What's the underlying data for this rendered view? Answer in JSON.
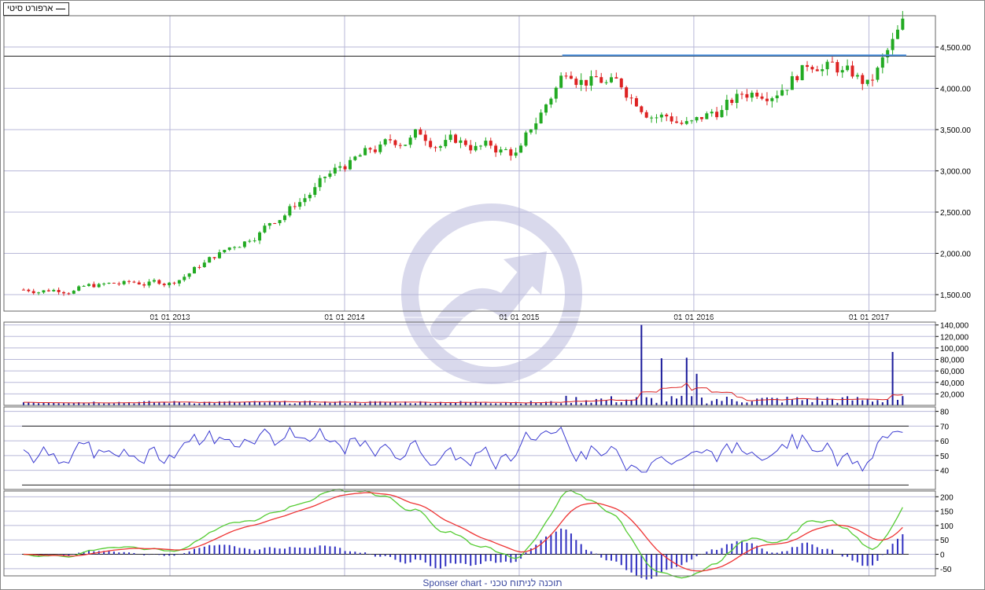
{
  "legend": {
    "label": "ארפורט סיטי"
  },
  "footer": {
    "text": "Sponser chart - תוכנה לניתוח טכני"
  },
  "colors": {
    "up": "#22aa22",
    "down": "#dd2222",
    "volume": "#1a1a9a",
    "volume_ma": "#dd2222",
    "rsi": "#3a3ad0",
    "macd_hist": "#3030c0",
    "macd_line": "#55cc33",
    "signal_line": "#ee3333",
    "resistance": "#4a90e0",
    "grid": "#b8b8d8",
    "watermark": "#d9d9ec"
  },
  "chart_data": [
    {
      "type": "candlestick",
      "title": "",
      "x_tick_labels": [
        "01-01-2013",
        "01-01-2014",
        "01-01-2015",
        "01-01-2016",
        "01-01-2017"
      ],
      "y_tick_labels": [
        "1,500.00",
        "2,000.00",
        "2,500.00",
        "3,000.00",
        "3,500.00",
        "4,000.00",
        "4,500.00"
      ],
      "ylim": [
        1300,
        4880
      ],
      "dates": [
        "2012-03-01",
        "2013-01-01",
        "2013-06-01",
        "2014-01-01",
        "2014-06-01",
        "2015-01-01",
        "2015-04-15",
        "2016-01-01",
        "2016-09-15",
        "2017-01-01",
        "2017-03-15"
      ],
      "anchor_closes": [
        1560,
        1650,
        2150,
        3050,
        3450,
        3200,
        4300,
        3550,
        4400,
        4000,
        4700
      ],
      "horizontal_line": 4390,
      "resistance_line": {
        "from": "2015-04-01",
        "to": "2017-03-20",
        "value": 4400
      }
    },
    {
      "type": "bar",
      "title": "",
      "series": [
        {
          "name": "",
          "kind": "volume"
        },
        {
          "name": "",
          "kind": "moving-average"
        }
      ],
      "y_tick_labels": [
        "140,000",
        "120,000",
        "100,000",
        "80,000",
        "60,000",
        "40,000",
        "20,000"
      ],
      "ylim": [
        0,
        145000
      ],
      "spikes": [
        {
          "date": "2015-09-10",
          "value": 140000
        },
        {
          "date": "2015-10-25",
          "value": 82000
        },
        {
          "date": "2015-12-15",
          "value": 83000
        },
        {
          "date": "2016-01-05",
          "value": 55000
        },
        {
          "date": "2017-02-20",
          "value": 93000
        }
      ]
    },
    {
      "type": "line",
      "title": "",
      "series": [
        {
          "name": "",
          "kind": "rsi"
        }
      ],
      "y_tick_labels": [
        "80",
        "70",
        "60",
        "50",
        "40"
      ],
      "ylim": [
        27,
        83
      ],
      "levels": [
        70,
        30
      ]
    },
    {
      "type": "line",
      "title": "",
      "series": [
        {
          "name": "",
          "kind": "macd"
        },
        {
          "name": "",
          "kind": "signal"
        },
        {
          "name": "",
          "kind": "histogram"
        }
      ],
      "y_tick_labels": [
        "200",
        "150",
        "100",
        "50",
        "0",
        "-50"
      ],
      "ylim": [
        -75,
        220
      ]
    }
  ]
}
